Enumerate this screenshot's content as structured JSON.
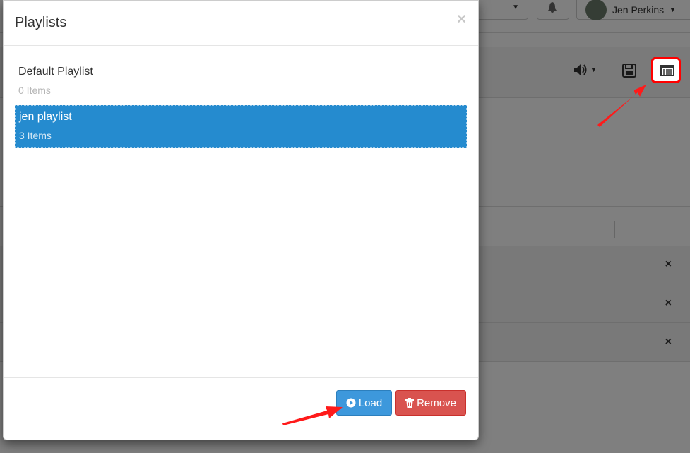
{
  "background": {
    "user_name": "Jen Perkins",
    "row_close_icon": "×"
  },
  "modal": {
    "title": "Playlists",
    "close_label": "×",
    "playlists": [
      {
        "name": "Default Playlist",
        "count": "0 Items",
        "selected": false
      },
      {
        "name": "jen playlist",
        "count": "3 Items",
        "selected": true
      }
    ],
    "buttons": {
      "load_label": "Load",
      "remove_label": "Remove"
    }
  },
  "colors": {
    "selected_bg": "#258bcf",
    "load_button": "#3d98dc",
    "remove_button": "#d9534f",
    "highlight": "#ff0000"
  },
  "icons": {
    "volume": "volume-icon",
    "save": "floppy-disk-icon",
    "playlist": "playlist-list-icon",
    "load": "play-circle-icon",
    "remove": "trash-icon"
  }
}
